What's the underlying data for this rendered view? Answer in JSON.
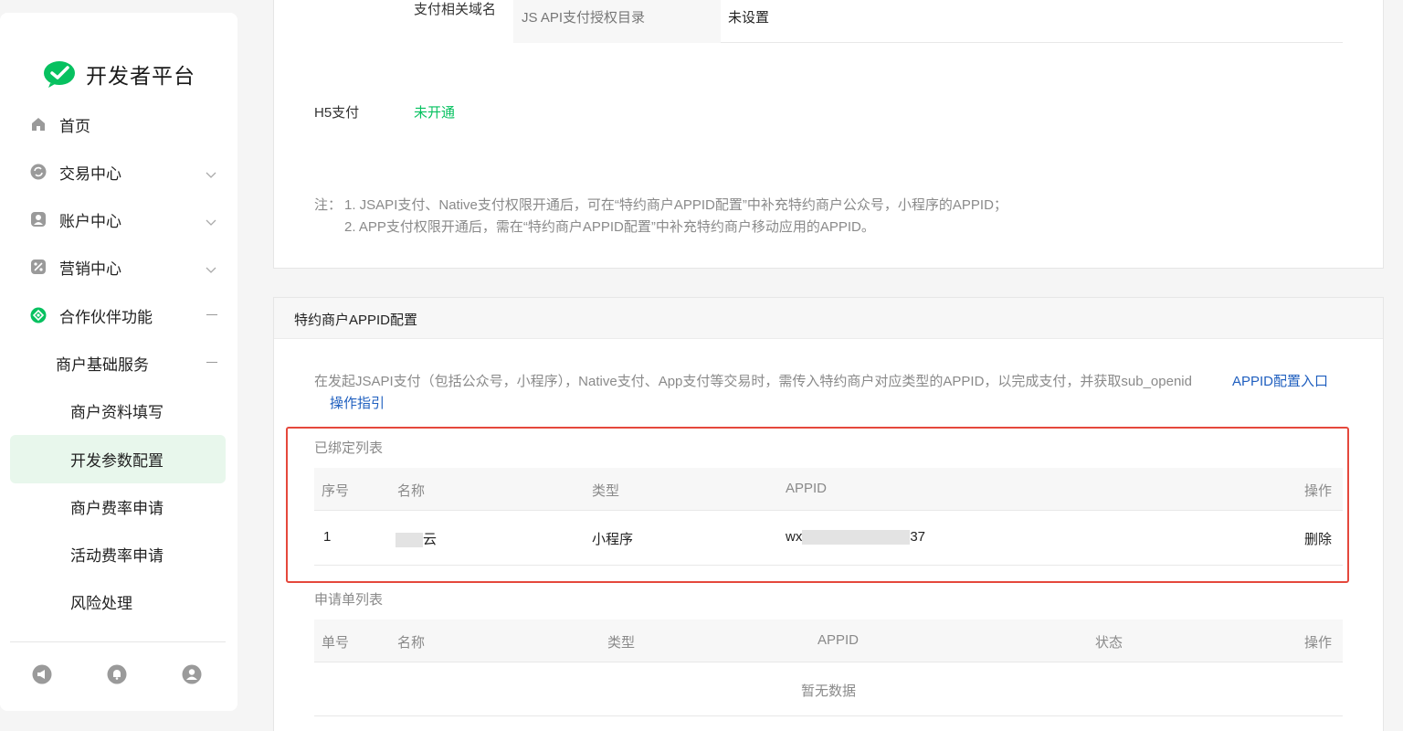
{
  "sidebar": {
    "brand": {
      "title": "开发者平台",
      "logo_icon": "wechat-logo-icon",
      "color": "#07c160"
    },
    "items": [
      {
        "label": "首页",
        "icon": "home-icon"
      },
      {
        "label": "交易中心",
        "icon": "transaction-icon"
      },
      {
        "label": "账户中心",
        "icon": "account-icon"
      },
      {
        "label": "营销中心",
        "icon": "marketing-icon"
      },
      {
        "label": "合作伙伴功能",
        "icon": "partner-icon"
      }
    ],
    "sub_group": "商户基础服务",
    "sub_items": [
      {
        "label": "商户资料填写"
      },
      {
        "label": "开发参数配置",
        "active": true
      },
      {
        "label": "商户费率申请"
      },
      {
        "label": "活动费率申请"
      },
      {
        "label": "风险处理"
      }
    ],
    "footer_icons": [
      "announcement-icon",
      "notification-bell-icon",
      "user-avatar-icon"
    ]
  },
  "payment_config": {
    "domain_label": "支付相关域名",
    "jsapi_key": "JS API支付授权目录",
    "jsapi_value": "未设置",
    "h5_label": "H5支付",
    "h5_status": "未开通",
    "note_prefix": "注：",
    "note_line1": "1. JSAPI支付、Native支付权限开通后，可在“特约商户APPID配置”中补充特约商户公众号，小程序的APPID；",
    "note_line2": "2. APP支付权限开通后，需在“特约商户APPID配置”中补充特约商户移动应用的APPID。"
  },
  "appid_config": {
    "title": "特约商户APPID配置",
    "description": "在发起JSAPI支付（包括公众号，小程序），Native支付、App支付等交易时，需传入特约商户对应类型的APPID，以完成支付，并获取sub_openid",
    "entry_link": "APPID配置入口",
    "guide_link": "操作指引",
    "bound_title": "已绑定列表",
    "bound_columns": [
      "序号",
      "名称",
      "类型",
      "APPID",
      "操作"
    ],
    "bound_rows": [
      {
        "index": "1",
        "name_suffix": "云",
        "type": "小程序",
        "appid_prefix": "wx",
        "appid_suffix": "37",
        "action": "删除"
      }
    ],
    "apply_title": "申请单列表",
    "apply_columns": [
      "单号",
      "名称",
      "类型",
      "APPID",
      "状态",
      "操作"
    ],
    "apply_empty": "暂无数据"
  },
  "colors": {
    "accent_green": "#07c160",
    "link_blue": "#1f5fbf",
    "highlight_red": "#e5483c"
  }
}
